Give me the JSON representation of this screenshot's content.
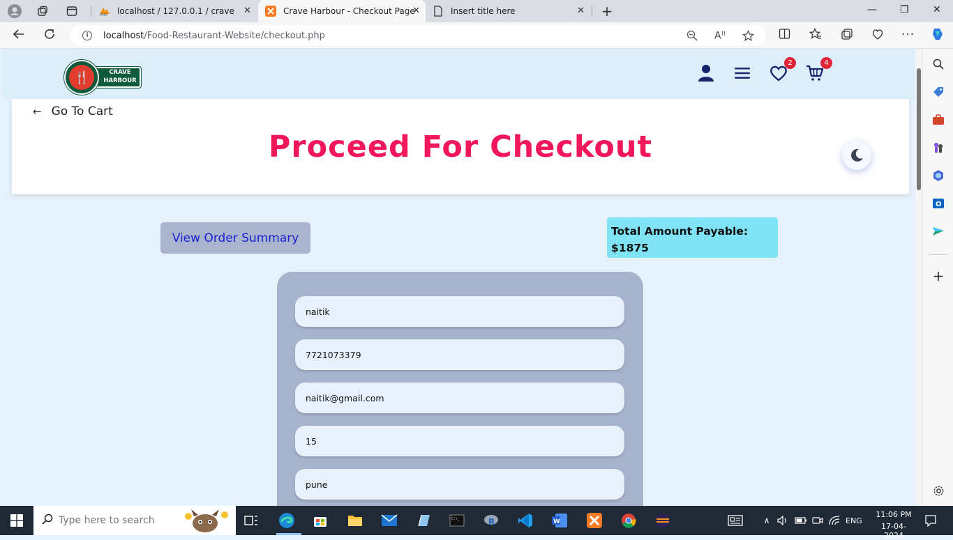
{
  "browser": {
    "tabs": [
      {
        "title": "localhost / 127.0.0.1 / crave | php",
        "favicon": "phpmyadmin-icon",
        "favicon_text": "PMA"
      },
      {
        "title": "Crave Harbour - Checkout Page",
        "favicon": "xampp-icon",
        "active": true
      },
      {
        "title": "Insert title here",
        "favicon": "document-icon"
      }
    ],
    "url_host": "localhost",
    "url_path": "/Food-Restaurant-Website/checkout.php"
  },
  "header": {
    "logo_line1": "CRAVE",
    "logo_line2": "HARBOUR",
    "wishlist_count": "2",
    "cart_count": "4"
  },
  "page": {
    "back_label": "Go To Cart",
    "title": "Proceed For Checkout",
    "summary_button": "View Order Summary",
    "total_label": "Total Amount Payable:",
    "total_value": "$1875"
  },
  "form": {
    "fields": [
      {
        "value": "naitik"
      },
      {
        "value": "7721073379"
      },
      {
        "value": "naitik@gmail.com"
      },
      {
        "value": "15"
      },
      {
        "value": "pune"
      }
    ]
  },
  "taskbar": {
    "search_placeholder": "Type here to search",
    "language": "ENG",
    "time": "11:06 PM",
    "date": "17-04-2024"
  },
  "colors": {
    "title": "#f2175a",
    "header_bg": "#dceefa",
    "accent_badge": "#e2243a",
    "total_box": "#7fe3f5"
  }
}
